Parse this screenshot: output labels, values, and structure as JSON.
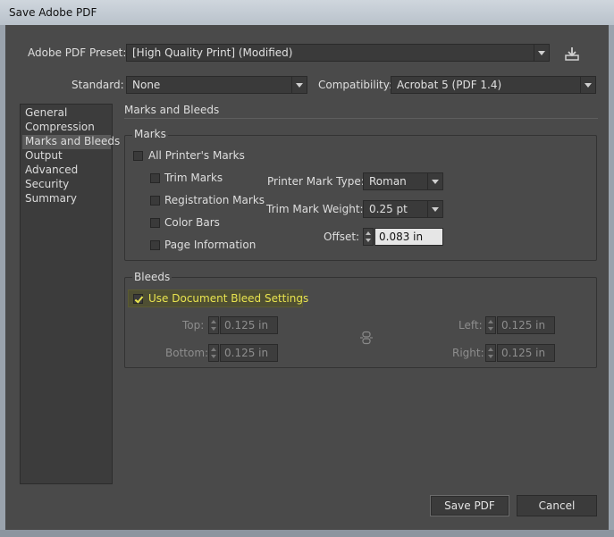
{
  "window": {
    "title": "Save Adobe PDF"
  },
  "preset": {
    "label": "Adobe PDF Preset:",
    "value": "[High Quality Print] (Modified)"
  },
  "standard": {
    "label": "Standard:",
    "value": "None"
  },
  "compatibility": {
    "label": "Compatibility:",
    "value": "Acrobat 5 (PDF 1.4)"
  },
  "sidebar": {
    "items": [
      {
        "label": "General"
      },
      {
        "label": "Compression"
      },
      {
        "label": "Marks and Bleeds"
      },
      {
        "label": "Output"
      },
      {
        "label": "Advanced"
      },
      {
        "label": "Security"
      },
      {
        "label": "Summary"
      }
    ],
    "selected": "Marks and Bleeds"
  },
  "section": {
    "title": "Marks and Bleeds"
  },
  "marks": {
    "group_title": "Marks",
    "all_printers_marks": {
      "label": "All Printer's Marks",
      "checked": false
    },
    "trim_marks": {
      "label": "Trim Marks",
      "checked": false
    },
    "registration_marks": {
      "label": "Registration Marks",
      "checked": false
    },
    "color_bars": {
      "label": "Color Bars",
      "checked": false
    },
    "page_information": {
      "label": "Page Information",
      "checked": false
    },
    "printer_mark_type": {
      "label": "Printer Mark Type:",
      "value": "Roman"
    },
    "trim_mark_weight": {
      "label": "Trim Mark Weight:",
      "value": "0.25 pt"
    },
    "offset": {
      "label": "Offset:",
      "value": "0.083 in"
    }
  },
  "bleeds": {
    "group_title": "Bleeds",
    "use_document_bleed": {
      "label": "Use Document Bleed Settings",
      "checked": true
    },
    "top": {
      "label": "Top:",
      "value": "0.125 in"
    },
    "bottom": {
      "label": "Bottom:",
      "value": "0.125 in"
    },
    "left": {
      "label": "Left:",
      "value": "0.125 in"
    },
    "right": {
      "label": "Right:",
      "value": "0.125 in"
    }
  },
  "footer": {
    "save_label": "Save PDF",
    "cancel_label": "Cancel"
  },
  "colors": {
    "accent_highlight": "#e9e44f",
    "panel_bg": "#4a4a4a",
    "field_bg": "#3a3a3a"
  }
}
